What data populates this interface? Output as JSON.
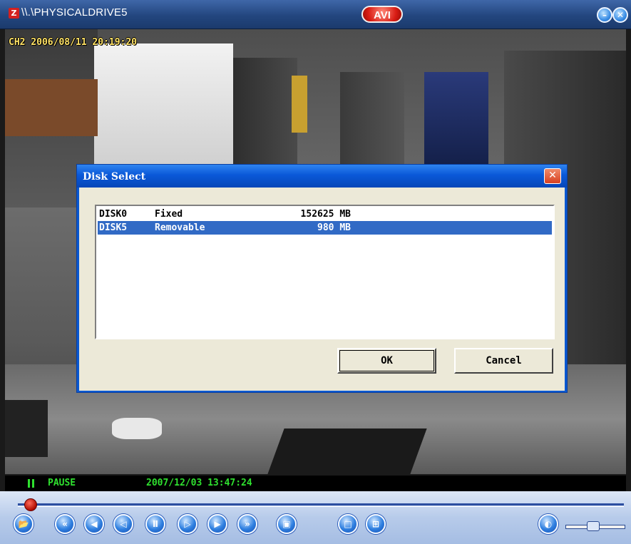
{
  "window": {
    "title": "\\\\.\\PHYSICALDRIVE5",
    "app_icon": "Z",
    "avi_button": "AVI",
    "minimize_glyph": "–",
    "close_glyph": "✕"
  },
  "video": {
    "osd_text": "CH2 2006/08/11 20:19:20"
  },
  "dialog": {
    "title": "Disk Select",
    "close_glyph": "✕",
    "disks": [
      {
        "name": "DISK0",
        "type": "Fixed",
        "size": "152625 MB",
        "selected": false
      },
      {
        "name": "DISK5",
        "type": "Removable",
        "size": "980 MB",
        "selected": true
      }
    ],
    "ok_label": "OK",
    "cancel_label": "Cancel"
  },
  "status": {
    "state": "PAUSE",
    "datetime": "2007/12/03 13:47:24",
    "color": "#2fe02f"
  },
  "controls": {
    "seek_progress": 0.01,
    "buttons": [
      {
        "name": "open-file-icon",
        "glyph": "📂"
      },
      {
        "name": "fast-rewind-icon",
        "glyph": "«"
      },
      {
        "name": "rewind-icon",
        "glyph": "◀"
      },
      {
        "name": "step-back-icon",
        "glyph": "◁"
      },
      {
        "name": "pause-icon",
        "glyph": "Ⅱ"
      },
      {
        "name": "step-forward-icon",
        "glyph": "▷"
      },
      {
        "name": "play-icon",
        "glyph": "▶"
      },
      {
        "name": "fast-forward-icon",
        "glyph": "»"
      },
      {
        "name": "snapshot-icon",
        "glyph": "▣"
      },
      {
        "name": "single-view-icon",
        "glyph": "□"
      },
      {
        "name": "quad-view-icon",
        "glyph": "⊞"
      },
      {
        "name": "volume-icon",
        "glyph": "◐"
      }
    ],
    "volume_level": 0.45
  }
}
